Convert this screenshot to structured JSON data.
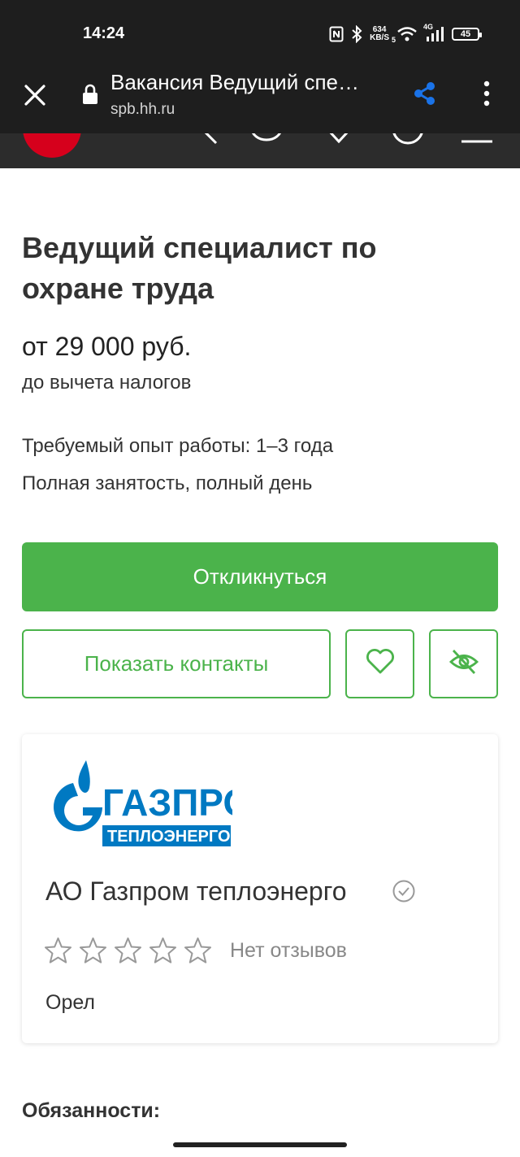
{
  "status_bar": {
    "time": "14:24",
    "net_speed_value": "634",
    "net_speed_unit": "KB/S",
    "wifi_badge": "5",
    "network_type": "4G",
    "battery": "45",
    "icons": [
      "nfc-icon",
      "bluetooth-icon",
      "wifi-icon",
      "signal-icon",
      "battery-icon"
    ]
  },
  "browser": {
    "title": "Вакансия Ведущий спе…",
    "url": "spb.hh.ru",
    "icons": [
      "close-icon",
      "lock-icon",
      "share-icon",
      "more-vert-icon"
    ],
    "accent": "#1a73e8"
  },
  "vacancy": {
    "title": "Ведущий специалист по охране труда",
    "salary": "от 29 000 руб.",
    "salary_note": "до вычета налогов",
    "experience": "Требуемый опыт работы: 1–3 года",
    "employment": "Полная занятость, полный день"
  },
  "actions": {
    "respond_label": "Откликнуться",
    "contacts_label": "Показать контакты",
    "favorite_icon": "heart-icon",
    "hide_icon": "eye-off-icon"
  },
  "company": {
    "logo_text_top": "ГАЗПРОМ",
    "logo_text_bottom": "ТЕПЛОЭНЕРГО",
    "name": "АО Газпром теплоэнерго",
    "rating_stars": 0,
    "rating_max": 5,
    "reviews_label": "Нет отзывов",
    "city": "Орел"
  },
  "sections": {
    "duties_heading": "Обязанности:"
  },
  "colors": {
    "brand_green": "#4bb34b",
    "hh_red": "#d6001c",
    "gazprom_blue": "#0079c2",
    "dark_bar": "#1e1e1e"
  }
}
